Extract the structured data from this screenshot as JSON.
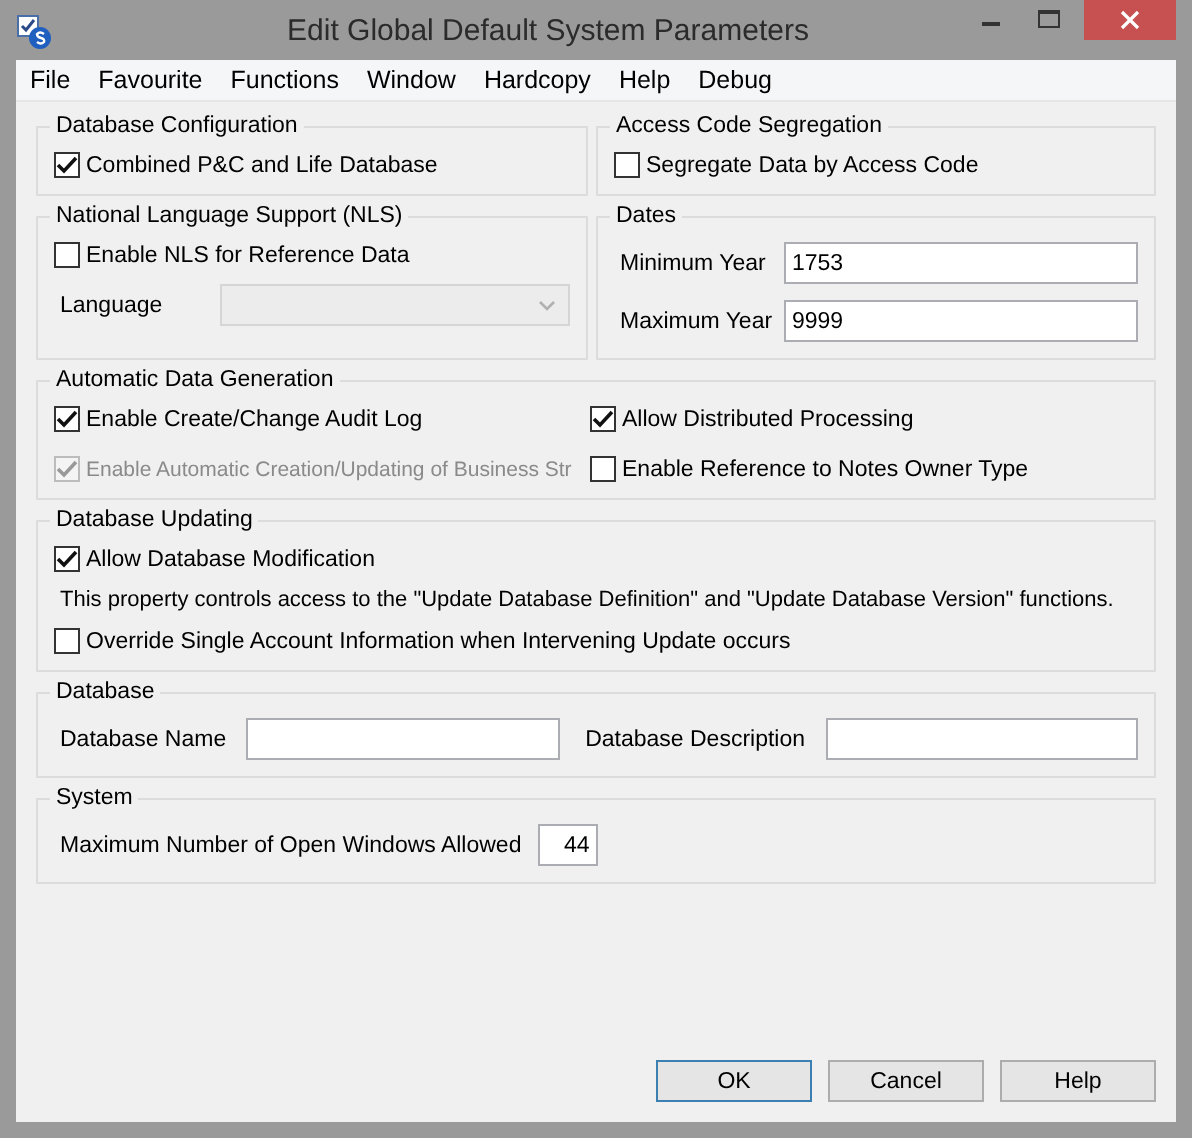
{
  "window": {
    "title": "Edit Global Default System Parameters"
  },
  "menu": [
    "File",
    "Favourite",
    "Functions",
    "Window",
    "Hardcopy",
    "Help",
    "Debug"
  ],
  "database_configuration": {
    "title": "Database Configuration",
    "checkbox": {
      "label": "Combined P&C and Life Database",
      "checked": true
    }
  },
  "access_code_segregation": {
    "title": "Access Code Segregation",
    "checkbox": {
      "label": "Segregate Data by Access Code",
      "checked": false
    }
  },
  "nls": {
    "title": "National Language Support (NLS)",
    "checkbox": {
      "label": "Enable NLS for Reference Data",
      "checked": false
    },
    "language": {
      "label": "Language",
      "disabled": true
    }
  },
  "dates": {
    "title": "Dates",
    "fields": [
      {
        "label": "Minimum Year",
        "value": "1753"
      },
      {
        "label": "Maximum Year",
        "value": "9999"
      }
    ]
  },
  "automatic_data_generation": {
    "title": "Automatic Data Generation",
    "checkboxes": [
      {
        "label": "Enable Create/Change Audit Log",
        "checked": true,
        "disabled": false
      },
      {
        "label": "Allow Distributed Processing",
        "checked": true,
        "disabled": false
      },
      {
        "label": "Enable Automatic Creation/Updating of Business Str",
        "checked": true,
        "disabled": true
      },
      {
        "label": "Enable Reference to Notes Owner Type",
        "checked": false,
        "disabled": false
      }
    ]
  },
  "database_updating": {
    "title": "Database Updating",
    "allow": {
      "label": "Allow Database Modification",
      "checked": true
    },
    "note": "This property controls access to the \"Update Database Definition\" and \"Update Database Version\" functions.",
    "override": {
      "label": "Override Single Account Information when Intervening Update occurs",
      "checked": false
    }
  },
  "database": {
    "title": "Database",
    "fields": [
      {
        "label": "Database Name"
      },
      {
        "label": "Database Description"
      }
    ]
  },
  "system": {
    "title": "System",
    "field": {
      "label": "Maximum Number of Open Windows Allowed",
      "value": "44"
    }
  },
  "buttons": [
    {
      "label": "OK",
      "default": true
    },
    {
      "label": "Cancel",
      "default": false
    },
    {
      "label": "Help",
      "default": false
    }
  ]
}
